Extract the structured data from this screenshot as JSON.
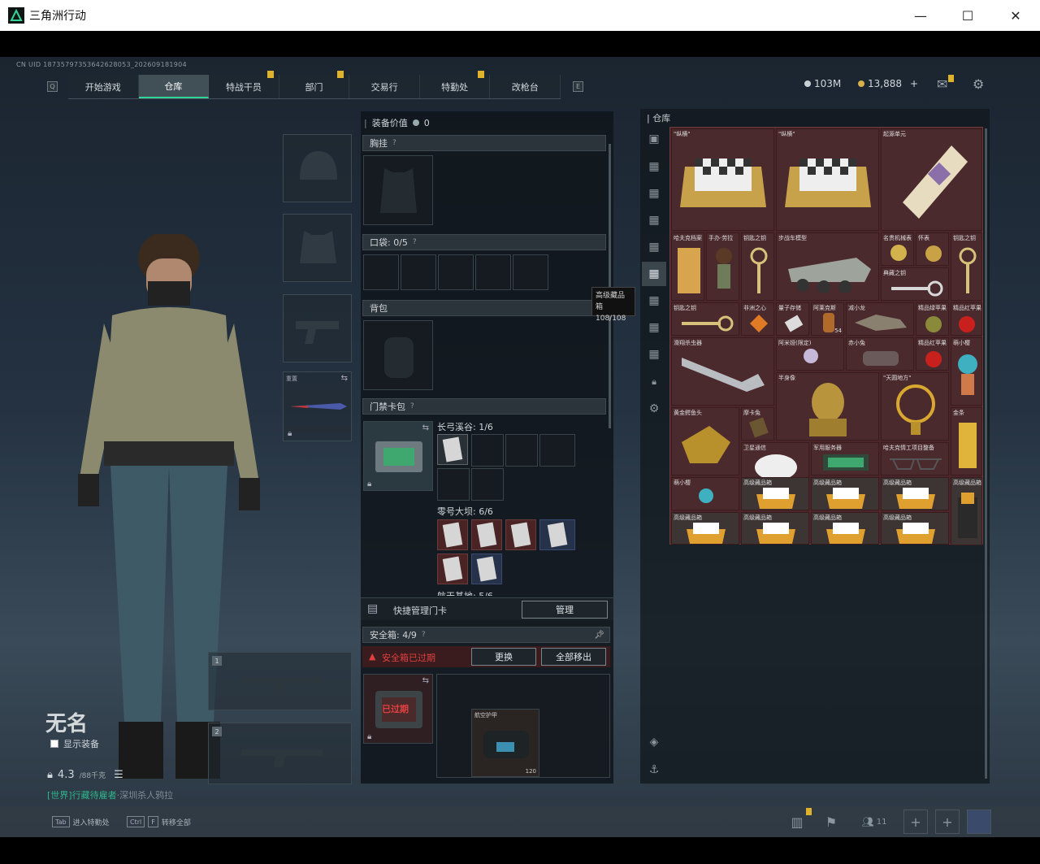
{
  "window": {
    "title": "三角洲行动"
  },
  "header": {
    "uid": "CN UID 18735797353642628053_202609181904",
    "tabs": [
      {
        "label": "开始游戏",
        "badge": false
      },
      {
        "label": "仓库",
        "badge": false,
        "active": true
      },
      {
        "label": "特战干员",
        "badge": true
      },
      {
        "label": "部门",
        "badge": true
      },
      {
        "label": "交易行",
        "badge": false
      },
      {
        "label": "特勤处",
        "badge": true
      },
      {
        "label": "改枪台",
        "badge": false
      }
    ],
    "key_left": "Q",
    "key_right": "E",
    "currency_a": "103M",
    "currency_b": "13,888",
    "plus": "+"
  },
  "character": {
    "name": "无名",
    "show_equipment": "显示装备",
    "weight": "4.3",
    "weight_max": "/88千克",
    "status_green": "[世界]行藏待雇者",
    "status_rest": "·深圳杀人鸦拉"
  },
  "loadout": {
    "melee_label": "重置",
    "weapon1_num": "1",
    "weapon2_num": "2"
  },
  "middle": {
    "equip_value_label": "装备价值",
    "equip_value": "0",
    "chest_rig": "胸挂",
    "pockets": "口袋: 0/5",
    "backpack": "背包",
    "keycard_pack": "门禁卡包",
    "map1": "长弓溪谷: 1/6",
    "map2": "零号大坝: 6/6",
    "map3": "航天基地: 5/6",
    "quick_manage": "快捷管理门卡",
    "manage": "管理",
    "safebox": "安全箱: 4/9",
    "safebox_expired": "安全箱已过期",
    "replace": "更换",
    "move_all": "全部移出",
    "expired_stamp": "已过期",
    "bag_label": "航空护甲",
    "bag_count": "120"
  },
  "tooltip": {
    "line1": "高级藏品箱",
    "line2": "108/108"
  },
  "warehouse": {
    "title": "仓库",
    "items": [
      {
        "label": "\"纵横\""
      },
      {
        "label": "\"纵横\""
      },
      {
        "label": "起源单元"
      },
      {
        "label": "哈夫克档案"
      },
      {
        "label": "手办·劳拉"
      },
      {
        "label": "钥匙之钥"
      },
      {
        "label": "步战车模型"
      },
      {
        "label": "名贵机械表"
      },
      {
        "label": "怀表"
      },
      {
        "label": "钥匙之钥"
      },
      {
        "label": "典藏之钥"
      },
      {
        "label": "钥匙之钥"
      },
      {
        "label": "非洲之心"
      },
      {
        "label": "量子存储"
      },
      {
        "label": "阿莱克斯"
      },
      {
        "label": "减小龙"
      },
      {
        "label": "精品绿苹果"
      },
      {
        "label": "精品红苹果"
      },
      {
        "label": "滑翔杀虫器"
      },
      {
        "label": "阿米娅(限定)"
      },
      {
        "label": "赤小兔"
      },
      {
        "label": "精品红苹果"
      },
      {
        "label": "萌小樱"
      },
      {
        "label": "半身像"
      },
      {
        "label": "\"天圆地方\""
      },
      {
        "label": "黄金鳄鱼头"
      },
      {
        "label": "摩卡兔"
      },
      {
        "label": "金条"
      },
      {
        "label": "卫星通信"
      },
      {
        "label": "军用服务器"
      },
      {
        "label": "哈夫克情工项目整备"
      },
      {
        "label": "萌小樱"
      },
      {
        "label": "高级藏品箱"
      },
      {
        "label": "高级藏品箱"
      },
      {
        "label": "高级藏品箱"
      },
      {
        "label": "高级藏品箱"
      },
      {
        "label": "高级藏品箱"
      },
      {
        "label": "高级藏品箱"
      },
      {
        "label": "高级藏品箱"
      },
      {
        "label": "高级藏品箱"
      }
    ],
    "count_amount": "54"
  },
  "footer": {
    "tab_key": "Tab",
    "tab_text": "进入特勤处",
    "ctrl_key": "Ctrl",
    "f_key": "F",
    "ctrlf_text": "转移全部",
    "friends": "11"
  },
  "colors": {
    "accent": "#35d39c",
    "badge": "#e0b12a",
    "danger": "#e04040",
    "inventory_bg": "#4a262a"
  }
}
